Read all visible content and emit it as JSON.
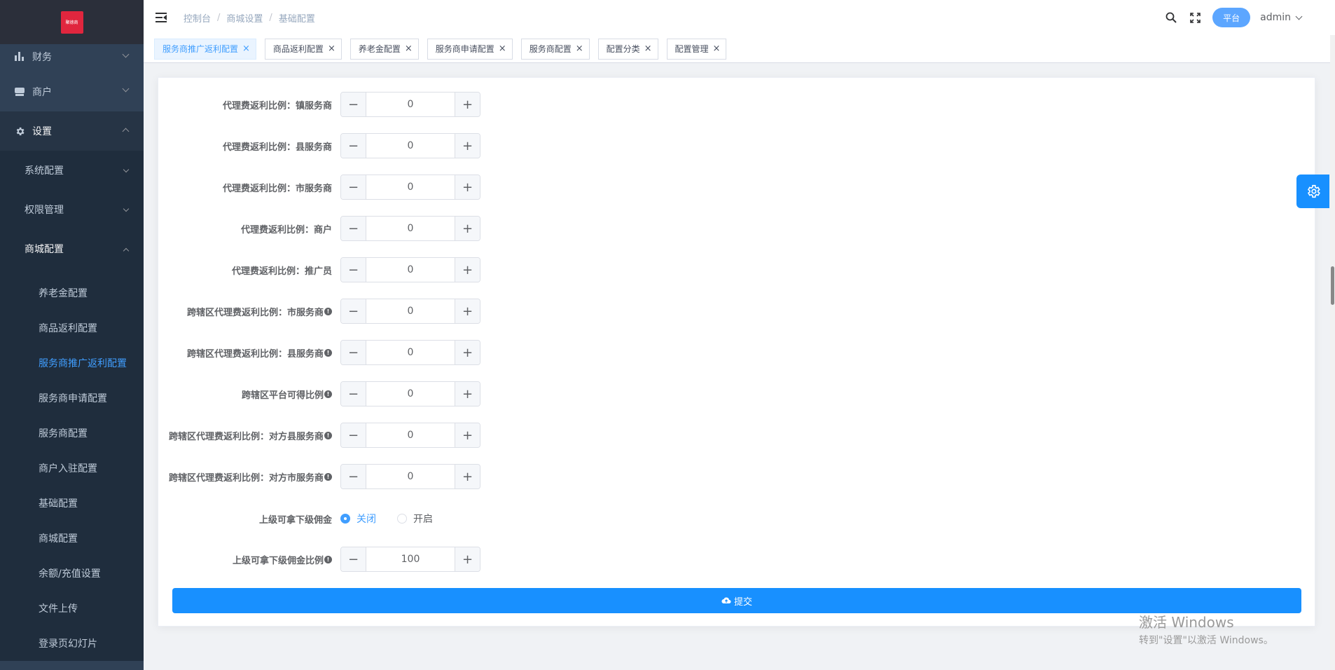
{
  "sidebar": {
    "logo_text": "聚德商",
    "top_items": [
      {
        "label": "财务"
      },
      {
        "label": "商户"
      },
      {
        "label": "设置"
      }
    ],
    "sub_items": [
      {
        "label": "系统配置"
      },
      {
        "label": "权限管理"
      },
      {
        "label": "商城配置"
      }
    ],
    "leaf_items": [
      {
        "label": "养老金配置"
      },
      {
        "label": "商品返利配置"
      },
      {
        "label": "服务商推广返利配置"
      },
      {
        "label": "服务商申请配置"
      },
      {
        "label": "服务商配置"
      },
      {
        "label": "商户入驻配置"
      },
      {
        "label": "基础配置"
      },
      {
        "label": "商城配置"
      },
      {
        "label": "余额/充值设置"
      },
      {
        "label": "文件上传"
      },
      {
        "label": "登录页幻灯片"
      }
    ]
  },
  "header": {
    "breadcrumb": [
      "控制台",
      "商城设置",
      "基础配置"
    ],
    "platform_label": "平台",
    "user": "admin"
  },
  "tags": [
    {
      "label": "服务商推广返利配置"
    },
    {
      "label": "商品返利配置"
    },
    {
      "label": "养老金配置"
    },
    {
      "label": "服务商申请配置"
    },
    {
      "label": "服务商配置"
    },
    {
      "label": "配置分类"
    },
    {
      "label": "配置管理"
    }
  ],
  "form": {
    "rows": [
      {
        "label": "代理费返利比例：镇服务商",
        "value": "0"
      },
      {
        "label": "代理费返利比例：县服务商",
        "value": "0"
      },
      {
        "label": "代理费返利比例：市服务商",
        "value": "0"
      },
      {
        "label": "代理费返利比例：商户",
        "value": "0"
      },
      {
        "label": "代理费返利比例：推广员",
        "value": "0"
      },
      {
        "label": "跨辖区代理费返利比例：市服务商",
        "value": "0"
      },
      {
        "label": "跨辖区代理费返利比例：县服务商",
        "value": "0"
      },
      {
        "label": "跨辖区平台可得比例",
        "value": "0"
      },
      {
        "label": "跨辖区代理费返利比例：对方县服务商",
        "value": "0"
      },
      {
        "label": "跨辖区代理费返利比例：对方市服务商",
        "value": "0"
      }
    ],
    "radio_label": "上级可拿下级佣金",
    "radio_options": [
      "关闭",
      "开启"
    ],
    "commission_label": "上级可拿下级佣金比例",
    "commission_value": "100",
    "stepper_minus": "−",
    "stepper_plus": "+",
    "info_mark": "!",
    "submit_label": "提交"
  },
  "watermark": {
    "line1": "激活 Windows",
    "line2": "转到\"设置\"以激活 Windows。"
  },
  "colors": {
    "sidebar_bg": "#304156",
    "accent": "#1890ff",
    "active_text": "#409eff"
  }
}
